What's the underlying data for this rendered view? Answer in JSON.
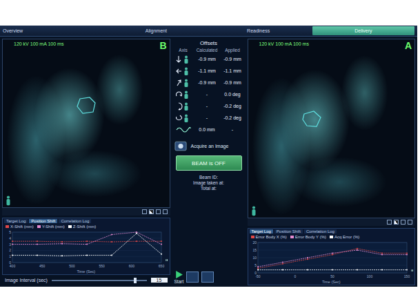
{
  "tabs": [
    {
      "label": "Overview",
      "selected": false
    },
    {
      "label": "Alignment",
      "selected": false
    },
    {
      "label": "Readiness",
      "selected": false
    },
    {
      "label": "Delivery",
      "selected": true
    }
  ],
  "views": [
    {
      "label": "B",
      "settings": "120 kV 100 mA 100 ms"
    },
    {
      "label": "A",
      "settings": "120 kV 100 mA 100 ms"
    }
  ],
  "offsets": {
    "title": "Offsets",
    "columns": [
      "Axis",
      "Calculated",
      "Applied"
    ],
    "rows": [
      {
        "kind": "down",
        "calculated": "-0.9 mm",
        "applied": "-0.9 mm"
      },
      {
        "kind": "left",
        "calculated": "-1.1 mm",
        "applied": "-1.1 mm"
      },
      {
        "kind": "forward",
        "calculated": "-0.9 mm",
        "applied": "-0.9 mm"
      },
      {
        "kind": "roll",
        "calculated": "-",
        "applied": "0.0 deg"
      },
      {
        "kind": "pitch",
        "calculated": "-",
        "applied": "-0.2 deg"
      },
      {
        "kind": "yaw",
        "calculated": "-",
        "applied": "-0.2 deg"
      },
      {
        "kind": "wave",
        "calculated": "0.0 mm",
        "applied": "-"
      }
    ]
  },
  "acquire": {
    "label": "Acquire an Image"
  },
  "beam": {
    "label": "BEAM is OFF",
    "on": false
  },
  "info": [
    "Beam ID:",
    "Image taken at:",
    "Total at:"
  ],
  "start": {
    "label": "Start"
  },
  "charts": [
    {
      "tabs": [
        {
          "label": "Target Log",
          "selected": false
        },
        {
          "label": "Position Shift",
          "selected": true
        },
        {
          "label": "Correlation Log",
          "selected": false
        }
      ],
      "yTicks": [
        "5",
        "4",
        "3",
        "2",
        "1",
        "0"
      ],
      "xTicks": [
        "400",
        "450",
        "500",
        "550",
        "600",
        "650"
      ],
      "xTitle": "Time (Sec)",
      "series": [
        {
          "label": "X-Shift (mm)",
          "color": "#e04848",
          "values": [
            3.5,
            3.5,
            3.4,
            3.5,
            3.4,
            3.5,
            3.5
          ]
        },
        {
          "label": "Y-Shift (mm)",
          "color": "#e58ad0",
          "values": [
            3.0,
            3.0,
            3.1,
            3.0,
            4.6,
            5.0,
            3.0
          ]
        },
        {
          "label": "Z-Shift (mm)",
          "color": "#ffffff",
          "values": [
            1.2,
            1.2,
            1.1,
            1.2,
            1.2,
            4.8,
            1.4
          ]
        }
      ]
    },
    {
      "tabs": [
        {
          "label": "Target Log",
          "selected": true
        },
        {
          "label": "Position Shift",
          "selected": false
        },
        {
          "label": "Correlation Log",
          "selected": false
        }
      ],
      "yTicks": [
        "20",
        "15",
        "10",
        "5",
        "0"
      ],
      "xTicks": [
        "-50",
        "0",
        "50",
        "100",
        "150"
      ],
      "xTitle": "Time (Sec)",
      "series": [
        {
          "label": "Error Body X (%)",
          "color": "#e04848",
          "values": [
            3,
            6,
            9,
            12,
            16,
            13,
            13
          ]
        },
        {
          "label": "Error Body Y (%)",
          "color": "#e58ad0",
          "values": [
            4,
            7,
            10,
            13,
            15,
            12,
            12
          ]
        },
        {
          "label": "Acq Error (%)",
          "color": "#ffffff",
          "values": [
            2,
            2,
            2,
            2,
            2,
            2,
            2
          ]
        }
      ]
    }
  ],
  "interval": {
    "label": "Image Interval (sec)",
    "value": "15",
    "level": 0.88
  }
}
